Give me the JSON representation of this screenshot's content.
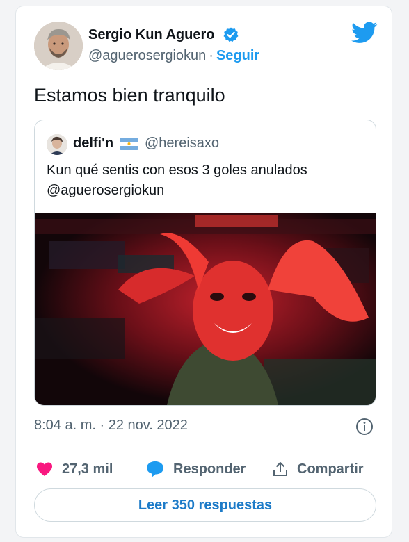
{
  "tweet": {
    "author_name": "Sergio Kun Aguero",
    "author_handle": "@aguerosergiokun",
    "separator": "·",
    "follow_label": "Seguir",
    "text": "Estamos bien tranquilo",
    "timestamp": "8:04 a. m. · 22 nov. 2022",
    "verified": true
  },
  "quoted": {
    "author_name": "delfi'n",
    "flag": "argentina-flag-icon",
    "author_handle": "@hereisaxo",
    "text_line1": "Kun qué sentis con esos 3 goles anulados",
    "text_line2": "@aguerosergiokun"
  },
  "actions": {
    "likes": "27,3 mil",
    "reply_label": "Responder",
    "share_label": "Compartir"
  },
  "replies_button": "Leer 350 respuestas",
  "colors": {
    "accent": "#1d9bf0",
    "like": "#f91880",
    "secondary_text": "#536471"
  }
}
